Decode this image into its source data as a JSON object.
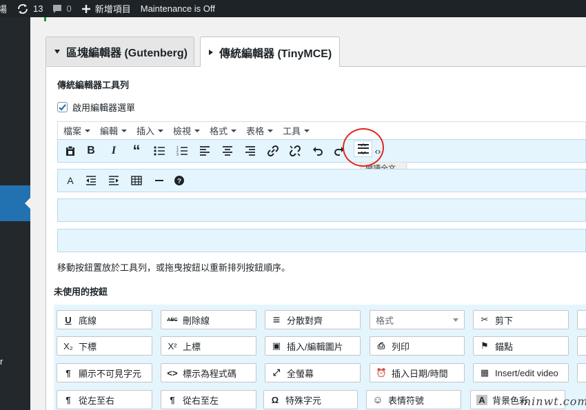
{
  "adminbar": {
    "cut_text": "場",
    "updates_count": "13",
    "comments_count": "0",
    "new_item": "新增項目",
    "maintenance": "Maintenance is Off"
  },
  "sidebar": {
    "cut_letter": "r"
  },
  "tabs": [
    {
      "label": "區塊編輯器 (Gutenberg)"
    },
    {
      "label": "傳統編輯器 (TinyMCE)"
    }
  ],
  "section_title": "傳統編輯器工具列",
  "enable_menu": {
    "label": "啟用編輯器選單",
    "checked": true
  },
  "menubar": [
    "檔案",
    "編輯",
    "插入",
    "檢視",
    "格式",
    "表格",
    "工具"
  ],
  "toolbar1_icons": [
    "paste-icon",
    "bold-icon",
    "italic-icon",
    "blockquote-icon",
    "bullet-list-icon",
    "numbered-list-icon",
    "align-left-icon",
    "align-center-icon",
    "align-right-icon",
    "link-icon",
    "unlink-icon",
    "undo-icon",
    "redo-icon",
    "read-more-icon",
    "code-icon"
  ],
  "toolbar2_icons": [
    "text-color-icon",
    "outdent-icon",
    "indent-icon",
    "table-icon",
    "horizontal-line-icon",
    "help-icon"
  ],
  "tooltip": "閱讀全文...",
  "help_text": "移動按鈕置放於工具列，或拖曳按鈕以重新排列按鈕順序。",
  "unused_title": "未使用的按鈕",
  "unused_buttons": [
    {
      "icon": "U",
      "label": "底線"
    },
    {
      "icon": "ABC",
      "label": "刪除線"
    },
    {
      "icon": "≡",
      "label": "分散對齊"
    },
    {
      "icon": "",
      "label": "格式"
    },
    {
      "icon": "✂",
      "label": "剪下"
    },
    {
      "icon": "X₂",
      "label": "下標"
    },
    {
      "icon": "X²",
      "label": "上標"
    },
    {
      "icon": "▣",
      "label": "插入/編輯圖片"
    },
    {
      "icon": "⎙",
      "label": "列印"
    },
    {
      "icon": "⚑",
      "label": "錨點"
    },
    {
      "icon": "¶",
      "label": "顯示不可見字元"
    },
    {
      "icon": "<>",
      "label": "標示為程式碼"
    },
    {
      "icon": "⤢",
      "label": "全螢幕"
    },
    {
      "icon": "⏰",
      "label": "插入日期/時間"
    },
    {
      "icon": "▦",
      "label": "Insert/edit video"
    },
    {
      "icon": "¶",
      "label": "從左至右"
    },
    {
      "icon": "¶",
      "label": "從右至左"
    },
    {
      "icon": "Ω",
      "label": "特殊字元"
    },
    {
      "icon": "☺",
      "label": "表情符號"
    },
    {
      "icon": "A",
      "label": "背景色彩"
    }
  ],
  "colors": {
    "adminbar": "#1d2327",
    "sidebar": "#23282d",
    "accent": "#2271b1",
    "toolbar_bg": "#e5f5fe",
    "highlight": "#e0271f"
  },
  "watermark": "minwt.com"
}
